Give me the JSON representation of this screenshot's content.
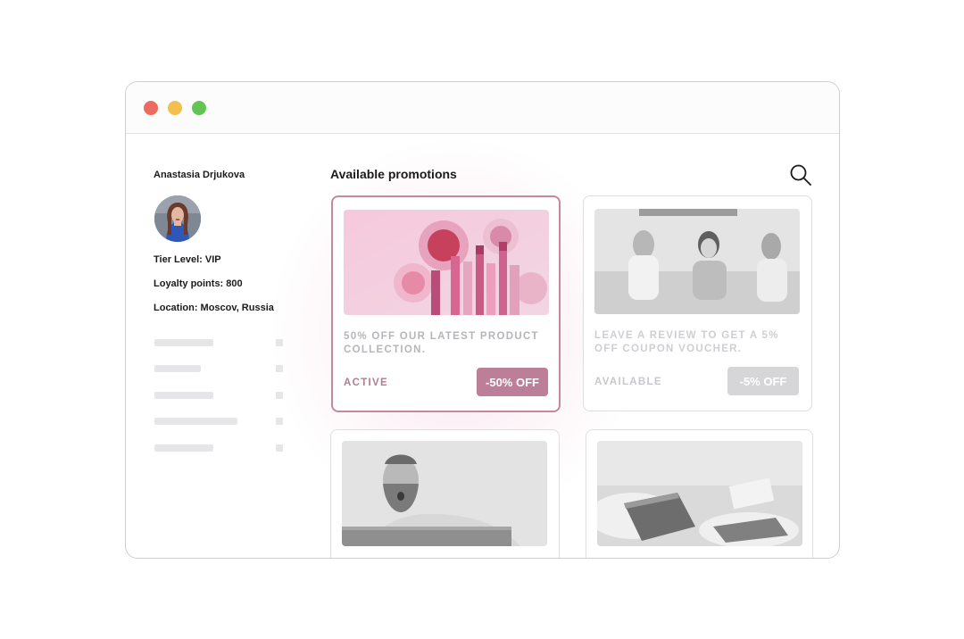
{
  "sidebar": {
    "user_name": "Anastasia Drjukova",
    "tier_level": "Tier Level: VIP",
    "loyalty_points": "Loyalty points: 800",
    "location": "Location: Moscov, Russia"
  },
  "main": {
    "title": "Available promotions",
    "promotions": [
      {
        "description": "50% OFF OUR LATEST PRODUCT COLLECTION.",
        "status": "ACTIVE",
        "badge": "-50% OFF",
        "image": "cosmetics-product-image"
      },
      {
        "description": "LEAVE A REVIEW TO GET A 5% OFF COUPON VOUCHER.",
        "status": "AVAILABLE",
        "badge": "-5% OFF",
        "image": "friends-on-sofa-image"
      },
      {
        "image": "surprised-man-image"
      },
      {
        "image": "cake-dessert-image"
      }
    ]
  },
  "colors": {
    "accent": "#bd7f98",
    "active_border": "#c4899f",
    "inactive_badge": "#d6d6d9",
    "traffic_red": "#ed6a5e",
    "traffic_yellow": "#f4bf4f",
    "traffic_green": "#61c554"
  },
  "icons": {
    "search": "search-icon"
  }
}
